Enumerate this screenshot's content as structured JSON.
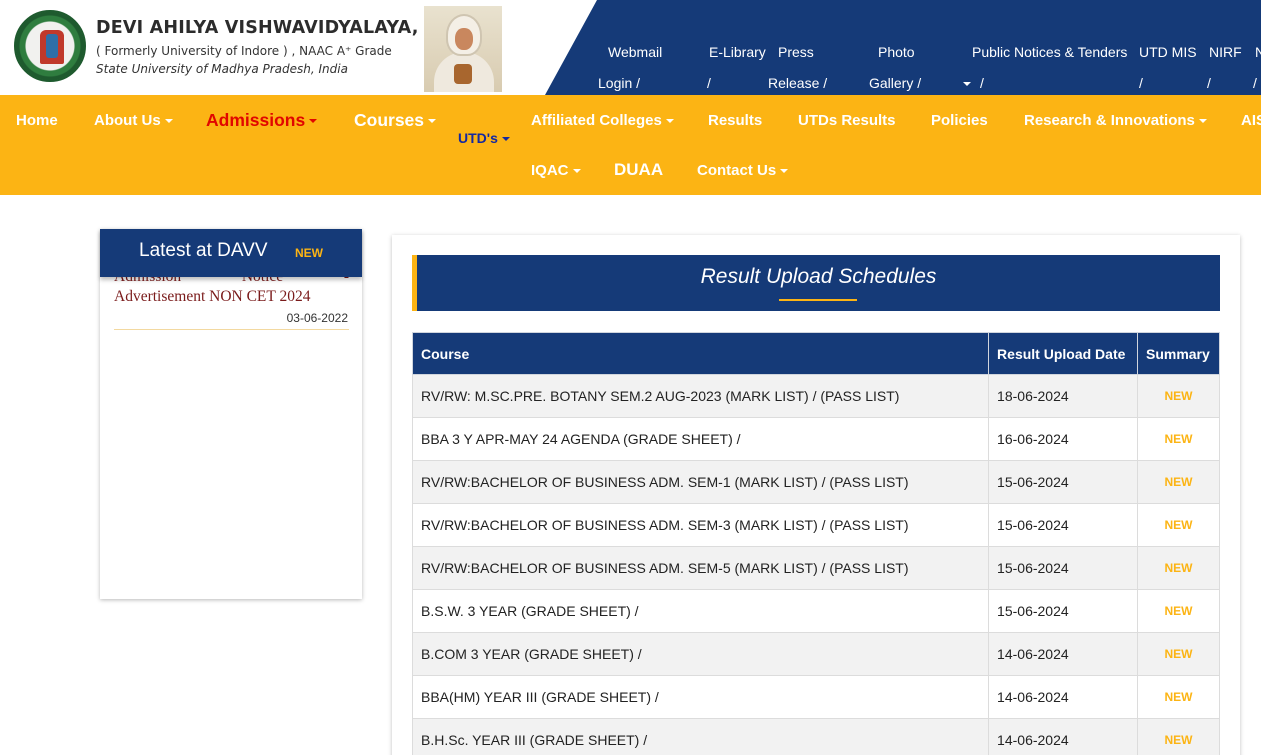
{
  "header": {
    "name": "DEVI AHILYA VISHWAVIDYALAYA, INDORE",
    "formerly": "( Formerly University of Indore ) , NAAC A⁺ Grade",
    "state": "State University of Madhya Pradesh, India",
    "top_links": {
      "webmail": "Webmail",
      "login": "Login  /",
      "elibrary": "E-Library",
      "elibrary_sep": "/",
      "press": "Press",
      "press2": "Release  /",
      "photo": "Photo",
      "photo2": "Gallery  /",
      "dropdown_sep": "/",
      "notices": "Public Notices & Tenders",
      "utdmis": "UTD MIS",
      "utdmis_sep": "/",
      "nirf": "NIRF",
      "nirf_sep": "/",
      "n": "N",
      "n_sep": "/"
    }
  },
  "nav": {
    "home": "Home",
    "about": "About Us",
    "admissions": "Admissions",
    "courses": "Courses",
    "utds": "UTD's",
    "affiliated": "Affiliated Colleges",
    "results": "Results",
    "utd_results": "UTDs Results",
    "policies": "Policies",
    "research": "Research & Innovations",
    "ais": "AIS",
    "iqac": "IQAC",
    "duaa": "DUAA",
    "contact": "Contact Us"
  },
  "sidebar": {
    "title": "Latest at DAVV",
    "badge": "NEW",
    "item_partial_1": "Admission",
    "item_partial_2": "Notice",
    "item_partial_3": "-",
    "item_line": "Advertisement NON CET 2024",
    "item_date": "03-06-2022"
  },
  "main": {
    "title": "Result Upload Schedules",
    "columns": [
      "Course",
      "Result Upload Date",
      "Summary"
    ],
    "rows": [
      {
        "course": "RV/RW: M.SC.PRE. BOTANY SEM.2 AUG-2023 (MARK LIST) / (PASS LIST)",
        "date": "18-06-2024",
        "summary": "NEW"
      },
      {
        "course": "BBA 3 Y APR-MAY 24 AGENDA (GRADE SHEET) /",
        "date": "16-06-2024",
        "summary": "NEW"
      },
      {
        "course": "RV/RW:BACHELOR OF BUSINESS ADM. SEM-1 (MARK LIST) / (PASS LIST)",
        "date": "15-06-2024",
        "summary": "NEW"
      },
      {
        "course": "RV/RW:BACHELOR OF BUSINESS ADM. SEM-3 (MARK LIST) / (PASS LIST)",
        "date": "15-06-2024",
        "summary": "NEW"
      },
      {
        "course": "RV/RW:BACHELOR OF BUSINESS ADM. SEM-5 (MARK LIST) / (PASS LIST)",
        "date": "15-06-2024",
        "summary": "NEW"
      },
      {
        "course": "B.S.W. 3 YEAR (GRADE SHEET) /",
        "date": "15-06-2024",
        "summary": "NEW"
      },
      {
        "course": "B.COM 3 YEAR (GRADE SHEET) /",
        "date": "14-06-2024",
        "summary": "NEW"
      },
      {
        "course": "BBA(HM) YEAR III (GRADE SHEET) /",
        "date": "14-06-2024",
        "summary": "NEW"
      },
      {
        "course": "B.H.Sc. YEAR III (GRADE SHEET) /",
        "date": "14-06-2024",
        "summary": "NEW"
      }
    ]
  },
  "colors": {
    "navy": "#153a78",
    "yellow": "#fcb414",
    "admissions_red": "#e10600",
    "utd_blue": "#1428a0",
    "news_maroon": "#7a1b1b"
  }
}
